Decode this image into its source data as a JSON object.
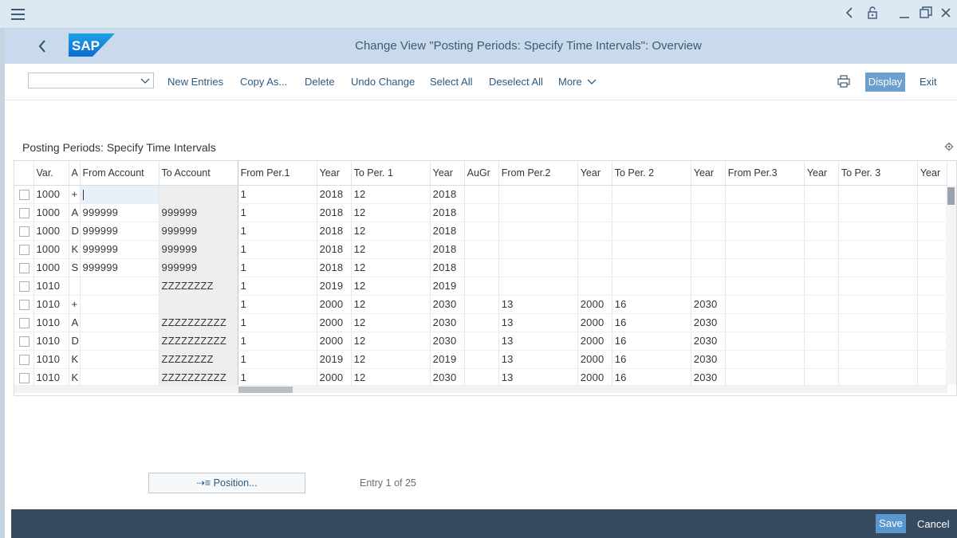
{
  "header": {
    "title": "Change View \"Posting Periods: Specify Time Intervals\": Overview",
    "logo_text": "SAP"
  },
  "toolbar": {
    "select_value": "",
    "new_entries": "New Entries",
    "copy_as": "Copy As...",
    "delete": "Delete",
    "undo_change": "Undo Change",
    "select_all": "Select All",
    "deselect_all": "Deselect All",
    "more": "More",
    "display": "Display",
    "exit": "Exit"
  },
  "section": {
    "title": "Posting Periods: Specify Time Intervals"
  },
  "table": {
    "columns": [
      "Var.",
      "A",
      "From Account",
      "To Account",
      "From Per.1",
      "Year",
      "To Per. 1",
      "Year",
      "AuGr",
      "From Per.2",
      "Year",
      "To Per. 2",
      "Year",
      "From Per.3",
      "Year",
      "To Per. 3",
      "Year"
    ],
    "rows": [
      [
        "1000",
        "+",
        "",
        "",
        "1",
        "2018",
        "12",
        "2018",
        "",
        "",
        "",
        "",
        "",
        "",
        "",
        "",
        ""
      ],
      [
        "1000",
        "A",
        "999999",
        "999999",
        "1",
        "2018",
        "12",
        "2018",
        "",
        "",
        "",
        "",
        "",
        "",
        "",
        "",
        ""
      ],
      [
        "1000",
        "D",
        "999999",
        "999999",
        "1",
        "2018",
        "12",
        "2018",
        "",
        "",
        "",
        "",
        "",
        "",
        "",
        "",
        ""
      ],
      [
        "1000",
        "K",
        "999999",
        "999999",
        "1",
        "2018",
        "12",
        "2018",
        "",
        "",
        "",
        "",
        "",
        "",
        "",
        "",
        ""
      ],
      [
        "1000",
        "S",
        "999999",
        "999999",
        "1",
        "2018",
        "12",
        "2018",
        "",
        "",
        "",
        "",
        "",
        "",
        "",
        "",
        ""
      ],
      [
        "1010",
        "",
        "",
        "ZZZZZZZZ",
        "1",
        "2019",
        "12",
        "2019",
        "",
        "",
        "",
        "",
        "",
        "",
        "",
        "",
        ""
      ],
      [
        "1010",
        "+",
        "",
        "",
        "1",
        "2000",
        "12",
        "2030",
        "",
        "13",
        "2000",
        "16",
        "2030",
        "",
        "",
        "",
        ""
      ],
      [
        "1010",
        "A",
        "",
        "ZZZZZZZZZZ",
        "1",
        "2000",
        "12",
        "2030",
        "",
        "13",
        "2000",
        "16",
        "2030",
        "",
        "",
        "",
        ""
      ],
      [
        "1010",
        "D",
        "",
        "ZZZZZZZZZZ",
        "1",
        "2000",
        "12",
        "2030",
        "",
        "13",
        "2000",
        "16",
        "2030",
        "",
        "",
        "",
        ""
      ],
      [
        "1010",
        "K",
        "",
        "ZZZZZZZZ",
        "1",
        "2019",
        "12",
        "2019",
        "",
        "13",
        "2000",
        "16",
        "2030",
        "",
        "",
        "",
        ""
      ],
      [
        "1010",
        "K",
        "",
        "ZZZZZZZZZZ",
        "1",
        "2000",
        "12",
        "2030",
        "",
        "13",
        "2000",
        "16",
        "2030",
        "",
        "",
        "",
        ""
      ]
    ]
  },
  "position_button": "⇢≡ Position...",
  "entry_info": "Entry 1 of 25",
  "footer": {
    "save": "Save",
    "cancel": "Cancel"
  },
  "colors": {
    "header_bg": "#c8daeb",
    "footer_bg": "#354a5f",
    "accent": "#6a9fcf"
  },
  "icons": [
    "menu-icon",
    "chevron-left-icon",
    "lock-icon",
    "minimize-icon",
    "restore-icon",
    "close-icon",
    "back-icon",
    "print-icon",
    "settings-icon"
  ]
}
